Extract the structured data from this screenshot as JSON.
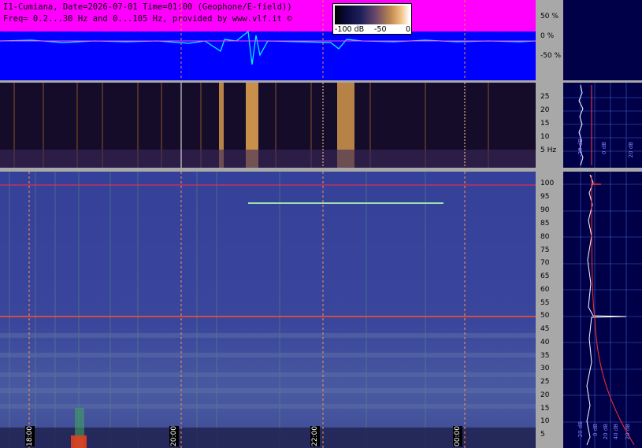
{
  "header": {
    "line1": "I1-Cumiana, Date=2026-07-01 Time=01:00 (Geophone/E-field))",
    "line2": "Freq= 0.2...30 Hz and 0...105 Hz, provided by www.vlf.it ©"
  },
  "colorbar": {
    "min_label": "-100 dB",
    "mid_label": "-50",
    "max_label": "0"
  },
  "top_axis": [
    "50 %",
    "0 %",
    "-50 %"
  ],
  "mid_axis": [
    "25",
    "20",
    "15",
    "10",
    "5 Hz"
  ],
  "main_axis": [
    "100",
    "95",
    "90",
    "85",
    "80",
    "75",
    "70",
    "65",
    "60",
    "55",
    "50",
    "45",
    "40",
    "35",
    "30",
    "25",
    "20",
    "15",
    "10",
    "5"
  ],
  "time_labels": [
    "18:00",
    "20:00",
    "22:00",
    "00:00"
  ],
  "right_mid_labels": [
    "-20 dB",
    "0 dB",
    "20 dB"
  ],
  "right_main_labels": [
    "-20 dB",
    "0 dB",
    "20 dB",
    "40 dB",
    "20 dB"
  ],
  "colors": {
    "magenta": "#ff00ff",
    "blue": "#0000ff",
    "cyan": "#00ffff",
    "dark_navy": "#000048"
  }
}
